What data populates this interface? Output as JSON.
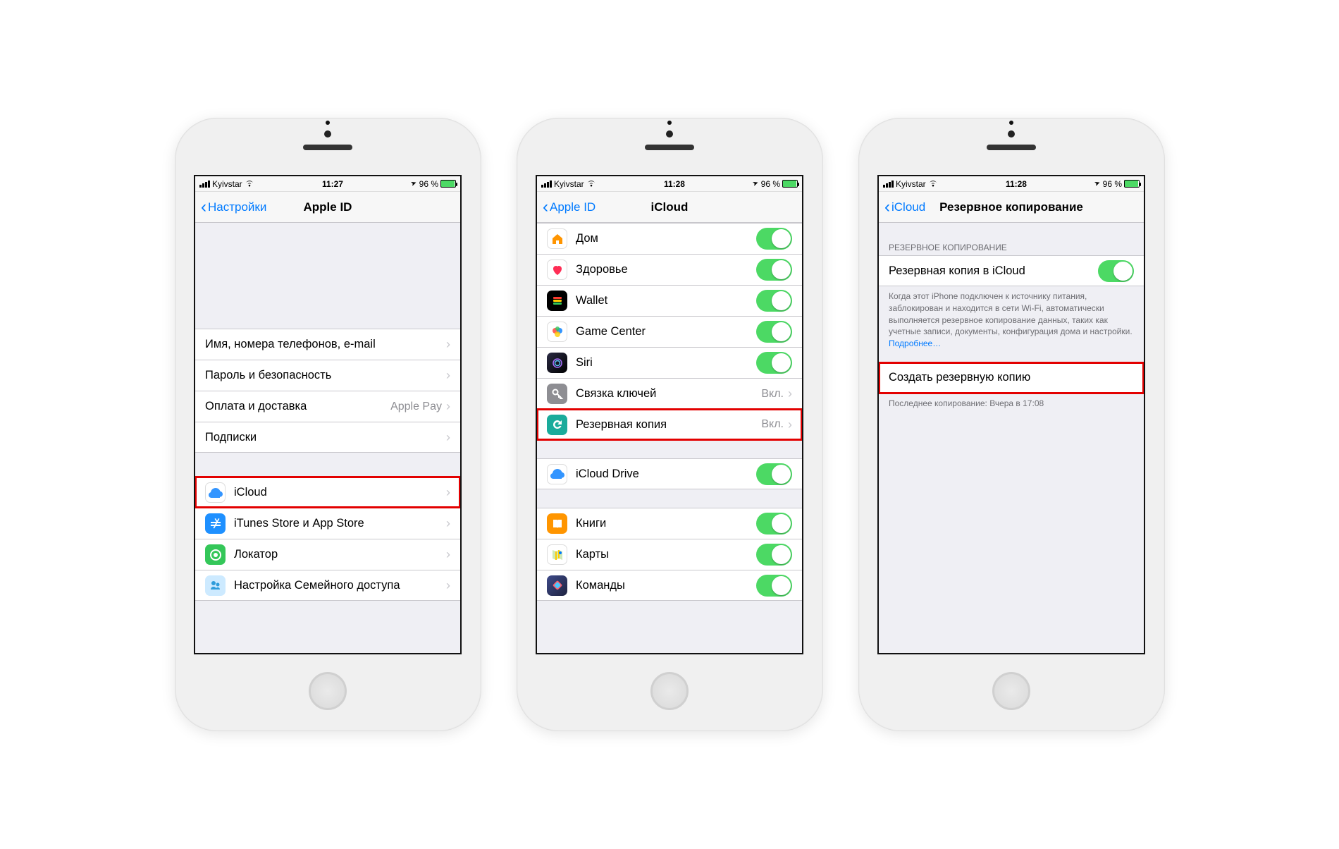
{
  "status": {
    "carrier": "Kyivstar",
    "time1": "11:27",
    "time2": "11:28",
    "time3": "11:28",
    "battery": "96 %",
    "location_glyph": "➤"
  },
  "phone1": {
    "back": "Настройки",
    "title": "Apple ID",
    "rows_a": [
      {
        "label": "Имя, номера телефонов, e-mail"
      },
      {
        "label": "Пароль и безопасность"
      },
      {
        "label": "Оплата и доставка",
        "detail": "Apple Pay"
      },
      {
        "label": "Подписки"
      }
    ],
    "rows_b": [
      {
        "label": "iCloud",
        "highlight": true
      },
      {
        "label": "iTunes Store и App Store"
      },
      {
        "label": "Локатор"
      },
      {
        "label": "Настройка Семейного доступа"
      }
    ]
  },
  "phone2": {
    "back": "Apple ID",
    "title": "iCloud",
    "rows_a": [
      {
        "label": "Дом"
      },
      {
        "label": "Здоровье"
      },
      {
        "label": "Wallet"
      },
      {
        "label": "Game Center"
      },
      {
        "label": "Siri"
      },
      {
        "label": "Связка ключей",
        "detail": "Вкл."
      },
      {
        "label": "Резервная копия",
        "detail": "Вкл.",
        "highlight": true
      }
    ],
    "rows_b": [
      {
        "label": "iCloud Drive"
      }
    ],
    "rows_c": [
      {
        "label": "Книги"
      },
      {
        "label": "Карты"
      },
      {
        "label": "Команды"
      }
    ]
  },
  "phone3": {
    "back": "iCloud",
    "title": "Резервное копирование",
    "section_header": "РЕЗЕРВНОЕ КОПИРОВАНИЕ",
    "toggle_label": "Резервная копия в iCloud",
    "footer": "Когда этот iPhone подключен к источнику питания, заблокирован и находится в сети Wi-Fi, автоматически выполняется резервное копирование данных, таких как учетные записи, документы, конфигурация дома и настройки.",
    "footer_link": "Подробнее…",
    "backup_now": "Создать резервную копию",
    "last_backup": "Последнее копирование: Вчера в 17:08"
  }
}
